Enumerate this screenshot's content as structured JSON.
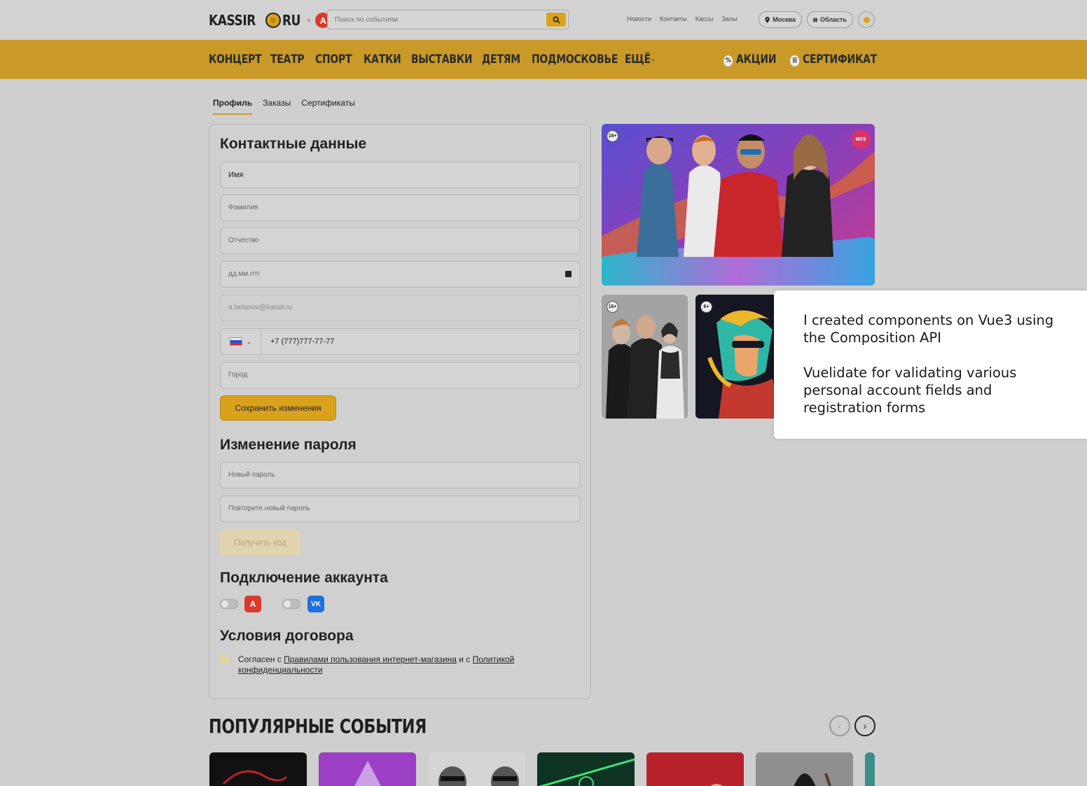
{
  "header": {
    "logo_text_left": "KASSIR",
    "logo_text_right": "RU",
    "logo_partner": "А",
    "search_placeholder": "Поиск по событиям",
    "links": [
      "Новости",
      "Контакты",
      "Кассы",
      "Залы"
    ],
    "city": "Москва",
    "region": "Область"
  },
  "nav": {
    "items": [
      "КОНЦЕРТ",
      "ТЕАТР",
      "СПОРТ",
      "КАТКИ",
      "ВЫСТАВКИ",
      "ДЕТЯМ",
      "ПОДМОСКОВЬЕ",
      "ЕЩЁ"
    ],
    "promo": "АКЦИИ",
    "certificate": "СЕРТИФИКАТ"
  },
  "tabs": [
    "Профиль",
    "Заказы",
    "Сертификаты"
  ],
  "contact": {
    "title": "Контактные данные",
    "first_name": "Имя",
    "last_name_placeholder": "Фамилия",
    "patronymic_placeholder": "Отчество",
    "birthdate_placeholder": "дд.мм.гггг",
    "email": "a.betanov@kassir.ru",
    "phone": "+7 (777)777-77-77",
    "city_placeholder": "Город",
    "save_label": "Сохранить изменения"
  },
  "password": {
    "title": "Изменение пароля",
    "new_placeholder": "Новый пароль",
    "repeat_placeholder": "Повторите новый пароль",
    "get_code_label": "Получить код"
  },
  "accounts": {
    "title": "Подключение аккаунта",
    "alfa_label": "А",
    "vk_label": "VK"
  },
  "terms": {
    "title": "Условия договора",
    "prefix": "Согласен с ",
    "rules_link": "Правилами пользования интернет-магазина",
    "middle": " и с ",
    "policy_link": "Политикой конфиденциальности"
  },
  "banners": {
    "main_age": "16+",
    "main_brand": "МУЗ",
    "small": [
      {
        "age": "16+"
      },
      {
        "age": "6+"
      }
    ]
  },
  "overlay": {
    "line1": "I created components on Vue3 using the Composition API",
    "line2": "Vuelidate for validating various personal account fields and registration forms"
  },
  "popular": {
    "title": "ПОПУЛЯРНЫЕ СОБЫТИЯ"
  },
  "colors": {
    "accent": "#c99a28",
    "button": "#d9a21a",
    "alfa": "#d93a2b",
    "vk": "#1f6fe0"
  }
}
